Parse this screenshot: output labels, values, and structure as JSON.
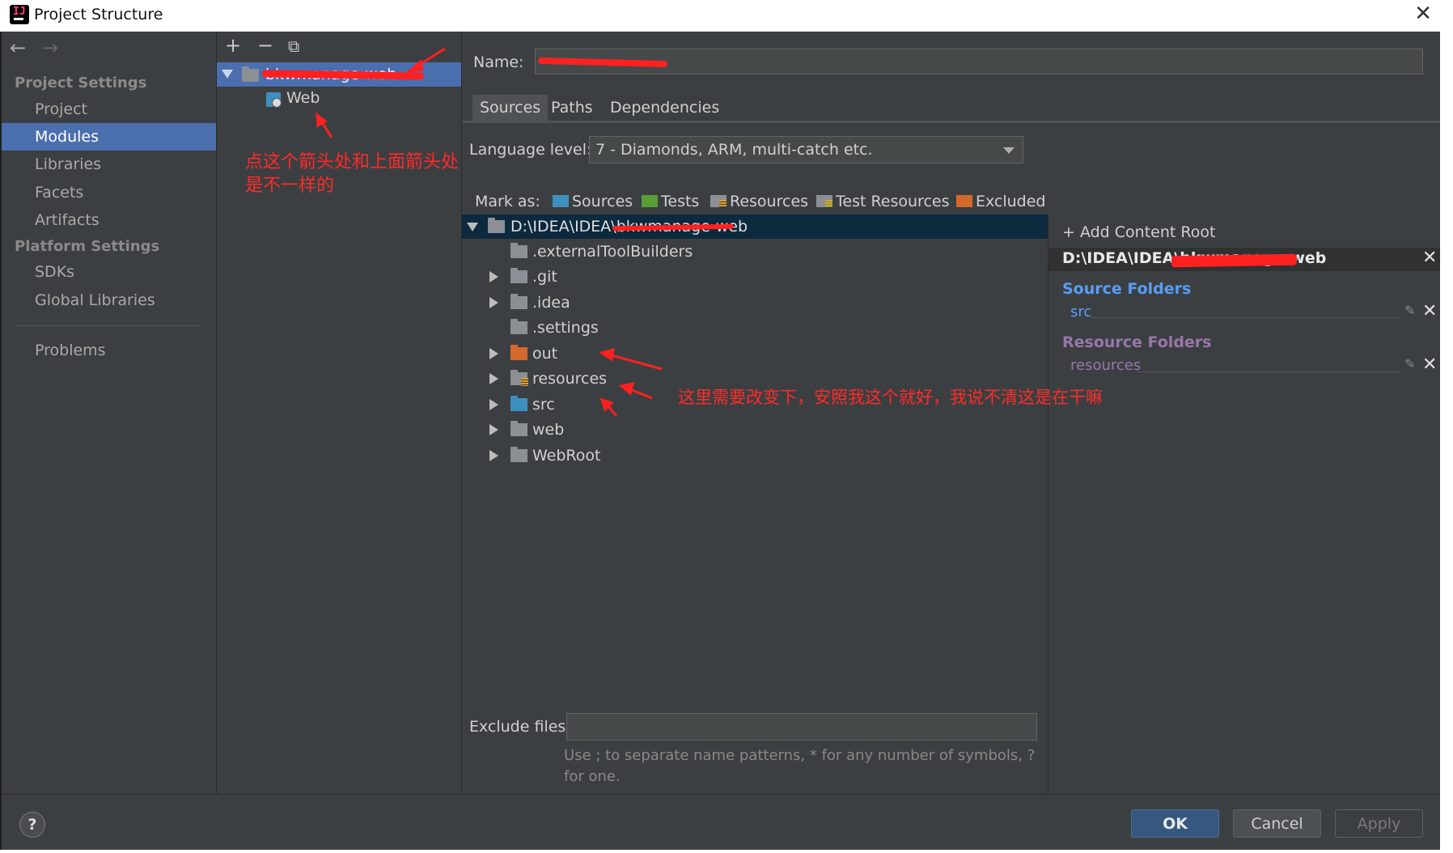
{
  "window": {
    "title": "Project Structure"
  },
  "nav": {
    "back": "←",
    "forward": "→"
  },
  "sidebar": {
    "project_settings_header": "Project Settings",
    "project_items": [
      "Project",
      "Modules",
      "Libraries",
      "Facets",
      "Artifacts"
    ],
    "platform_settings_header": "Platform Settings",
    "platform_items": [
      "SDKs",
      "Global Libraries"
    ],
    "problems": "Problems",
    "selected": "Modules"
  },
  "module_panel": {
    "toolbar": {
      "add": "+",
      "remove": "−",
      "copy": "⧉"
    },
    "module_name": "bkwmanage-web",
    "facet": "Web"
  },
  "main": {
    "name_label": "Name:",
    "name_value": "bkwmanage-web",
    "tabs": [
      "Sources",
      "Paths",
      "Dependencies"
    ],
    "active_tab": "Sources",
    "language_level_label": "Language level:",
    "language_level_value": "7 - Diamonds, ARM, multi-catch etc.",
    "mark_as_label": "Mark as:",
    "mark_as": [
      {
        "label": "Sources",
        "color": "#3d8fbf"
      },
      {
        "label": "Tests",
        "color": "#5a9e3a"
      },
      {
        "label": "Resources",
        "color": "#8c9094"
      },
      {
        "label": "Test Resources",
        "color": "#8c9094"
      },
      {
        "label": "Excluded",
        "color": "#d7682b"
      }
    ],
    "tree_root": "D:\\IDEA\\IDEA\\bkwmanage-web",
    "tree_children": [
      {
        "name": ".externalToolBuilders",
        "expandable": false,
        "type": "plain"
      },
      {
        "name": ".git",
        "expandable": true,
        "type": "plain"
      },
      {
        "name": ".idea",
        "expandable": true,
        "type": "plain"
      },
      {
        "name": ".settings",
        "expandable": false,
        "type": "plain"
      },
      {
        "name": "out",
        "expandable": true,
        "type": "excluded"
      },
      {
        "name": "resources",
        "expandable": true,
        "type": "resources"
      },
      {
        "name": "src",
        "expandable": true,
        "type": "sources"
      },
      {
        "name": "web",
        "expandable": true,
        "type": "plain"
      },
      {
        "name": "WebRoot",
        "expandable": true,
        "type": "plain"
      }
    ],
    "exclude_files_label": "Exclude files:",
    "exclude_files_value": "",
    "exclude_hint": "Use ; to separate name patterns, * for any number of symbols, ? for one."
  },
  "content_root": {
    "add_label": "+ Add Content Root",
    "path": "D:\\IDEA\\IDEA\\bkwmanage-web",
    "source_folders_title": "Source Folders",
    "source_folders": [
      "src"
    ],
    "resource_folders_title": "Resource Folders",
    "resource_folders": [
      "resources"
    ]
  },
  "buttons": {
    "help": "?",
    "ok": "OK",
    "cancel": "Cancel",
    "apply": "Apply"
  },
  "annotations": {
    "note_1": "点这个箭头处和上面箭头处是不一样的",
    "note_2": "这里需要改变下，安照我这个就好，我说不清这是在干嘛"
  },
  "colors": {
    "accent": "#4b6eaf",
    "source_blue": "#589df6",
    "resource_purple": "#9876aa",
    "annotation_red": "#ff2a2a"
  }
}
